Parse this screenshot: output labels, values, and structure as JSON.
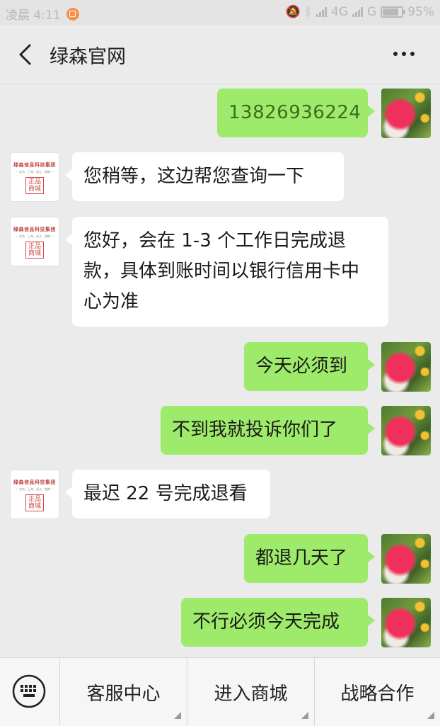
{
  "status_bar": {
    "time_text": "凌晨 4:11",
    "network_1": "4G",
    "network_2": "G",
    "battery_text": "95%"
  },
  "header": {
    "title": "绿森官网"
  },
  "service_avatar": {
    "brand": "绿森信息科技集团",
    "tagline": "— 北京、上海、浙江、湖南 —",
    "stamp": "正品商城"
  },
  "messages": [
    {
      "side": "right",
      "text": "13826936224"
    },
    {
      "side": "left",
      "text": "您稍等，这边帮您查询一下"
    },
    {
      "side": "left",
      "text": "您好，会在 1-3 个工作日完成退款，具体到账时间以银行信用卡中心为准"
    },
    {
      "side": "right",
      "text": "今天必须到"
    },
    {
      "side": "right",
      "text": "不到我就投诉你们了"
    },
    {
      "side": "left",
      "text": "最迟 22 号完成退看"
    },
    {
      "side": "right",
      "text": "都退几天了"
    },
    {
      "side": "right",
      "text": "不行必须今天完成"
    }
  ],
  "bottom_menu": {
    "items": [
      {
        "label": "客服中心"
      },
      {
        "label": "进入商城"
      },
      {
        "label": "战略合作"
      }
    ]
  },
  "colors": {
    "outgoing_bubble": "#9eea6a",
    "incoming_bubble": "#ffffff",
    "background": "#ebebeb"
  }
}
